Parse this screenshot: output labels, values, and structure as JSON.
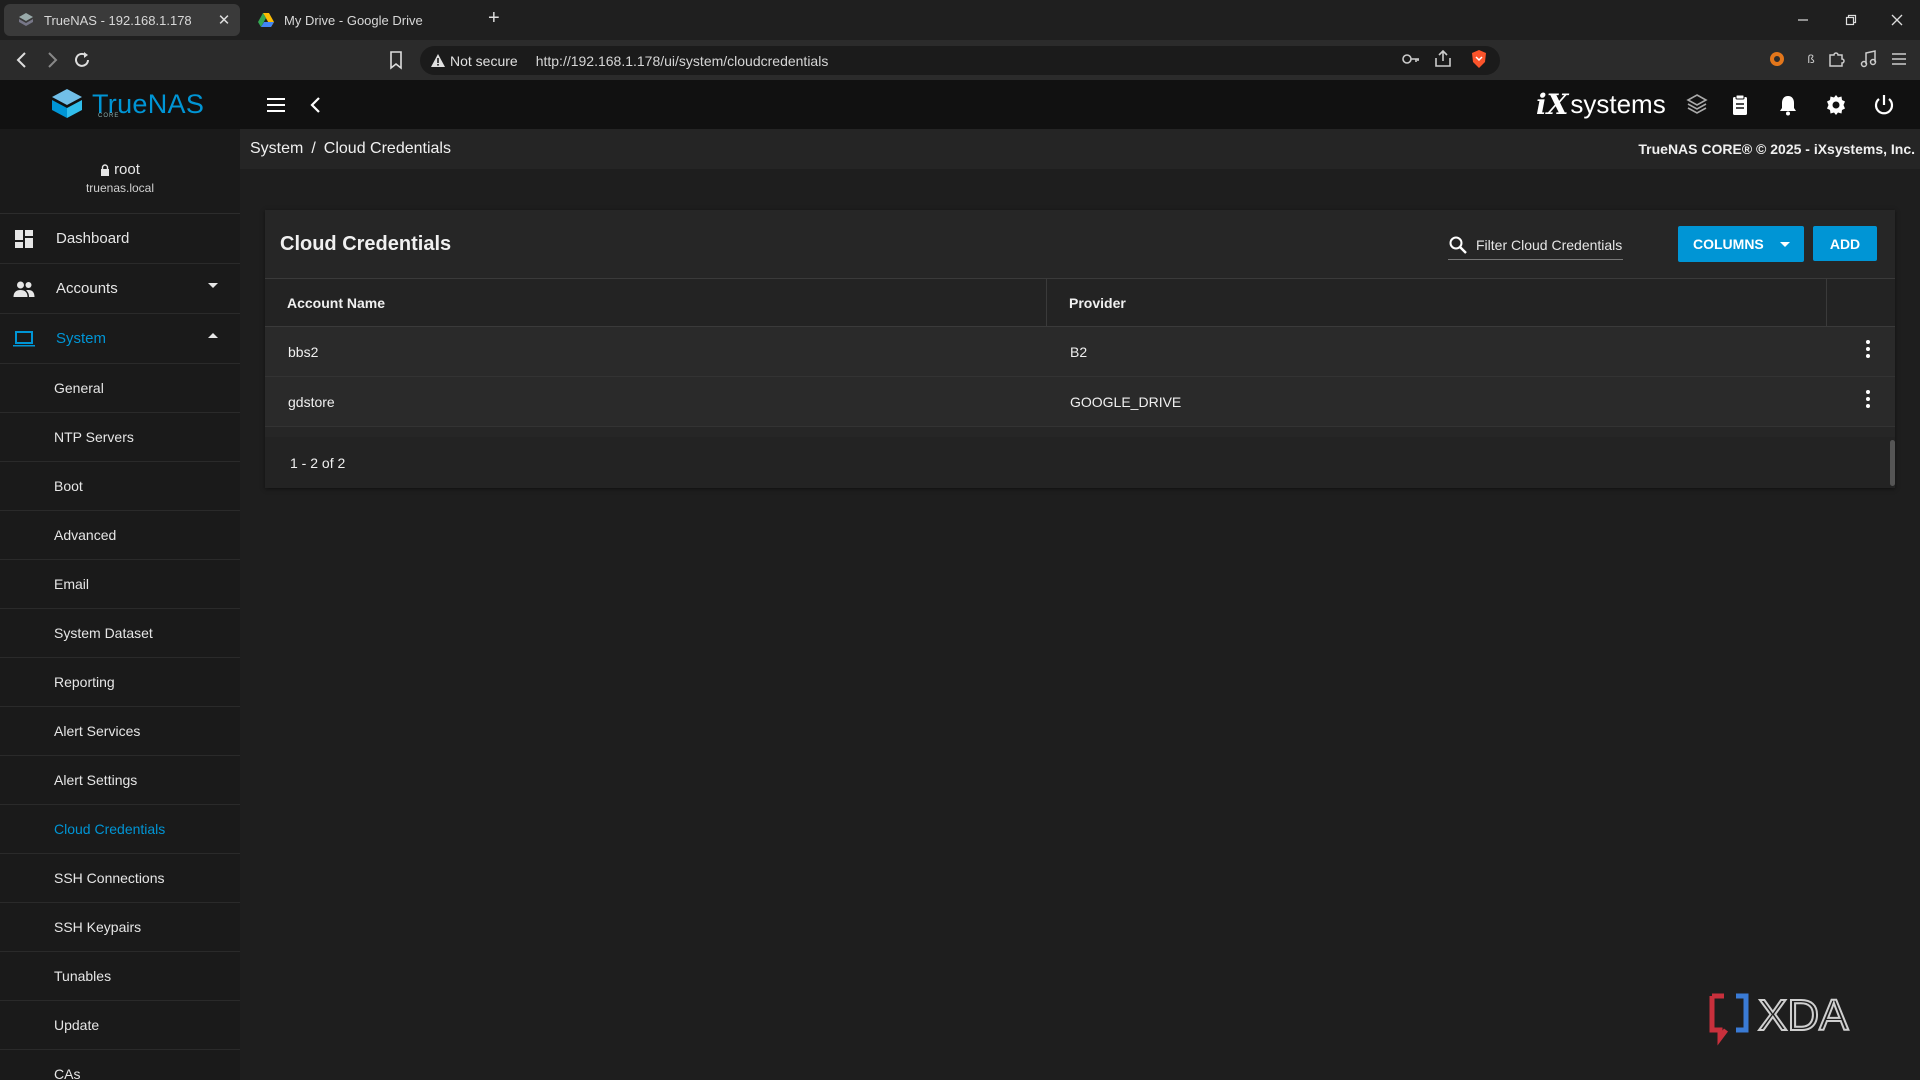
{
  "browser": {
    "tabs": [
      {
        "title": "TrueNAS - 192.168.1.178",
        "icon": "truenas-favicon"
      },
      {
        "title": "My Drive - Google Drive",
        "icon": "google-drive-icon"
      }
    ],
    "security_label": "Not secure",
    "url": "http://192.168.1.178/ui/system/cloudcredentials"
  },
  "app": {
    "logo_text": "TrueNAS",
    "logo_sub": "CORE",
    "vendor_mark": "iX",
    "vendor_text": "systems"
  },
  "user": {
    "name": "root",
    "host": "truenas.local"
  },
  "sidebar": {
    "items": [
      {
        "label": "Dashboard",
        "icon": "dashboard-icon"
      },
      {
        "label": "Accounts",
        "icon": "accounts-icon"
      },
      {
        "label": "System",
        "icon": "laptop-icon"
      }
    ],
    "system_children": [
      "General",
      "NTP Servers",
      "Boot",
      "Advanced",
      "Email",
      "System Dataset",
      "Reporting",
      "Alert Services",
      "Alert Settings",
      "Cloud Credentials",
      "SSH Connections",
      "SSH Keypairs",
      "Tunables",
      "Update",
      "CAs"
    ],
    "active_child": "Cloud Credentials"
  },
  "breadcrumb": {
    "parent": "System",
    "separator": "/",
    "current": "Cloud Credentials"
  },
  "copyright": "TrueNAS CORE® © 2025 - iXsystems, Inc.",
  "card": {
    "title": "Cloud Credentials",
    "filter_placeholder": "Filter Cloud Credentials",
    "columns_label": "COLUMNS",
    "add_label": "ADD"
  },
  "table": {
    "headers": [
      "Account Name",
      "Provider"
    ],
    "rows": [
      {
        "account": "bbs2",
        "provider": "B2"
      },
      {
        "account": "gdstore",
        "provider": "GOOGLE_DRIVE"
      }
    ],
    "pagination": "1 - 2 of 2"
  },
  "watermark": "XDA",
  "colors": {
    "accent": "#0095d5",
    "sidebar_bg": "#1a1a1a",
    "topbar_bg": "#111111",
    "content_bg": "#1e1e1e"
  }
}
